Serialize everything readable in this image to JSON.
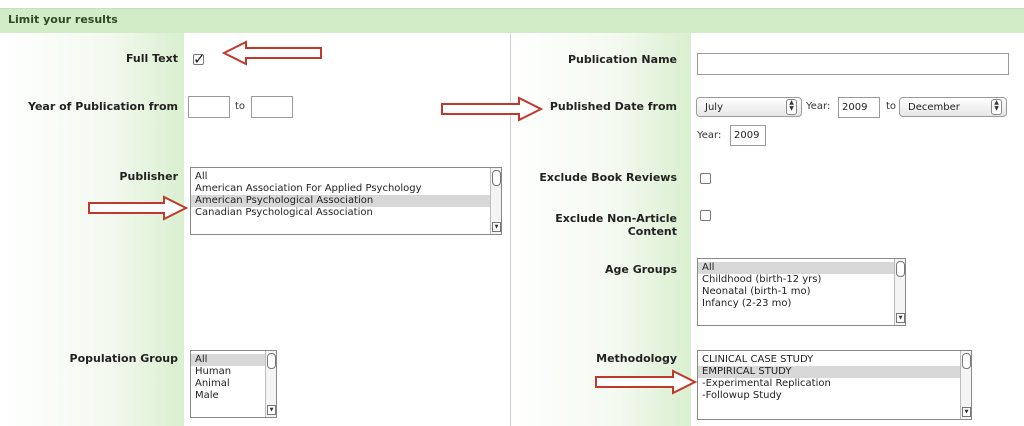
{
  "header": {
    "title": "Limit your results"
  },
  "left": {
    "full_text": {
      "label": "Full Text",
      "checked": true
    },
    "year_pub": {
      "label": "Year of Publication from",
      "to_label": "to",
      "from_value": "",
      "to_value": ""
    },
    "publisher": {
      "label": "Publisher",
      "options": [
        "All",
        "American Association For Applied Psychology",
        "American Psychological Association",
        "Canadian Psychological Association"
      ],
      "selected_index": 2
    },
    "population": {
      "label": "Population Group",
      "options": [
        "All",
        "Human",
        "Animal",
        "Male"
      ],
      "selected_index": 0
    }
  },
  "right": {
    "pub_name": {
      "label": "Publication Name",
      "value": ""
    },
    "pub_date": {
      "label": "Published Date from",
      "from_month": "July",
      "year_label_1": "Year:",
      "from_year": "2009",
      "to_label": "to",
      "to_month": "December",
      "year_label_2": "Year:",
      "to_year": "2009"
    },
    "exclude_reviews": {
      "label": "Exclude Book Reviews"
    },
    "exclude_nonarticle": {
      "label_line1": "Exclude Non-Article",
      "label_line2": "Content"
    },
    "age_groups": {
      "label": "Age Groups",
      "options": [
        "All",
        "Childhood (birth-12 yrs)",
        "Neonatal (birth-1 mo)",
        "Infancy (2-23 mo)"
      ],
      "selected_index": 0
    },
    "methodology": {
      "label": "Methodology",
      "options": [
        "CLINICAL CASE STUDY",
        "EMPIRICAL STUDY",
        "-Experimental Replication",
        "-Followup Study"
      ],
      "selected_index": 1
    }
  },
  "colors": {
    "header_bg": "#d2ecc7",
    "arrow_stroke": "#c0392b",
    "gradient_end": "#d9efcf"
  }
}
